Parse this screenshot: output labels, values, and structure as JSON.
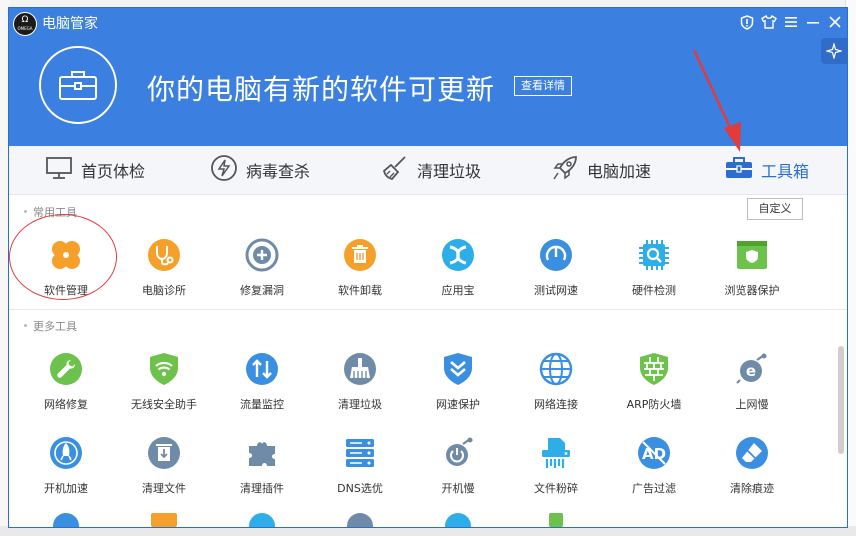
{
  "window": {
    "title": "电脑管家",
    "logo_text": "OMEGA"
  },
  "banner": {
    "headline": "你的电脑有新的软件可更新",
    "detail_button": "查看详情"
  },
  "tabs": [
    {
      "label": "首页体检",
      "icon": "monitor-icon",
      "active": false
    },
    {
      "label": "病毒查杀",
      "icon": "lightning-icon",
      "active": false
    },
    {
      "label": "清理垃圾",
      "icon": "broom-icon",
      "active": false
    },
    {
      "label": "电脑加速",
      "icon": "rocket-icon",
      "active": false
    },
    {
      "label": "工具箱",
      "icon": "toolbox-icon",
      "active": true
    }
  ],
  "common_tools": {
    "label": "常用工具",
    "customize_button": "自定义",
    "items": [
      {
        "label": "软件管理",
        "icon": "clover-icon",
        "color": "#f6a02c"
      },
      {
        "label": "电脑诊所",
        "icon": "stethoscope-icon",
        "color": "#f6a02c"
      },
      {
        "label": "修复漏洞",
        "icon": "patch-icon",
        "color": "#6f8ba8"
      },
      {
        "label": "软件卸载",
        "icon": "trash-icon",
        "color": "#f6a02c"
      },
      {
        "label": "应用宝",
        "icon": "appstore-icon",
        "color": "#2eaee8"
      },
      {
        "label": "测试网速",
        "icon": "speedometer-icon",
        "color": "#3b8fe0"
      },
      {
        "label": "硬件检测",
        "icon": "chip-icon",
        "color": "#2eaee8"
      },
      {
        "label": "浏览器保护",
        "icon": "browser-shield-icon",
        "color": "#6cc24a"
      }
    ]
  },
  "more_tools": {
    "label": "更多工具",
    "rows": [
      [
        {
          "label": "网络修复",
          "icon": "wrench-icon",
          "color": "#6cc24a"
        },
        {
          "label": "无线安全助手",
          "icon": "wifi-shield-icon",
          "color": "#6cc24a"
        },
        {
          "label": "流量监控",
          "icon": "traffic-icon",
          "color": "#3b8fe0"
        },
        {
          "label": "清理垃圾",
          "icon": "broom-icon",
          "color": "#6f8ba8"
        },
        {
          "label": "网速保护",
          "icon": "chevron-shield-icon",
          "color": "#3b8fe0"
        },
        {
          "label": "网络连接",
          "icon": "globe-icon",
          "color": "#3b8fe0"
        },
        {
          "label": "ARP防火墙",
          "icon": "firewall-icon",
          "color": "#6cc24a"
        },
        {
          "label": "上网慢",
          "icon": "ie-bug-icon",
          "color": "#6f8ba8"
        }
      ],
      [
        {
          "label": "开机加速",
          "icon": "boot-rocket-icon",
          "color": "#3b8fe0"
        },
        {
          "label": "清理文件",
          "icon": "file-clean-icon",
          "color": "#6f8ba8"
        },
        {
          "label": "清理插件",
          "icon": "puzzle-icon",
          "color": "#6f8ba8"
        },
        {
          "label": "DNS选优",
          "icon": "server-icon",
          "color": "#3b8fe0"
        },
        {
          "label": "开机慢",
          "icon": "boot-slow-icon",
          "color": "#6f8ba8"
        },
        {
          "label": "文件粉碎",
          "icon": "shredder-icon",
          "color": "#2eaee8"
        },
        {
          "label": "广告过滤",
          "icon": "ad-block-icon",
          "color": "#3b8fe0"
        },
        {
          "label": "清除痕迹",
          "icon": "eraser-icon",
          "color": "#3b8fe0"
        }
      ]
    ]
  },
  "colors": {
    "header_blue": "#3b7fe0",
    "active_tab": "#2a6fcf",
    "annotation_red": "#e23b3b"
  }
}
